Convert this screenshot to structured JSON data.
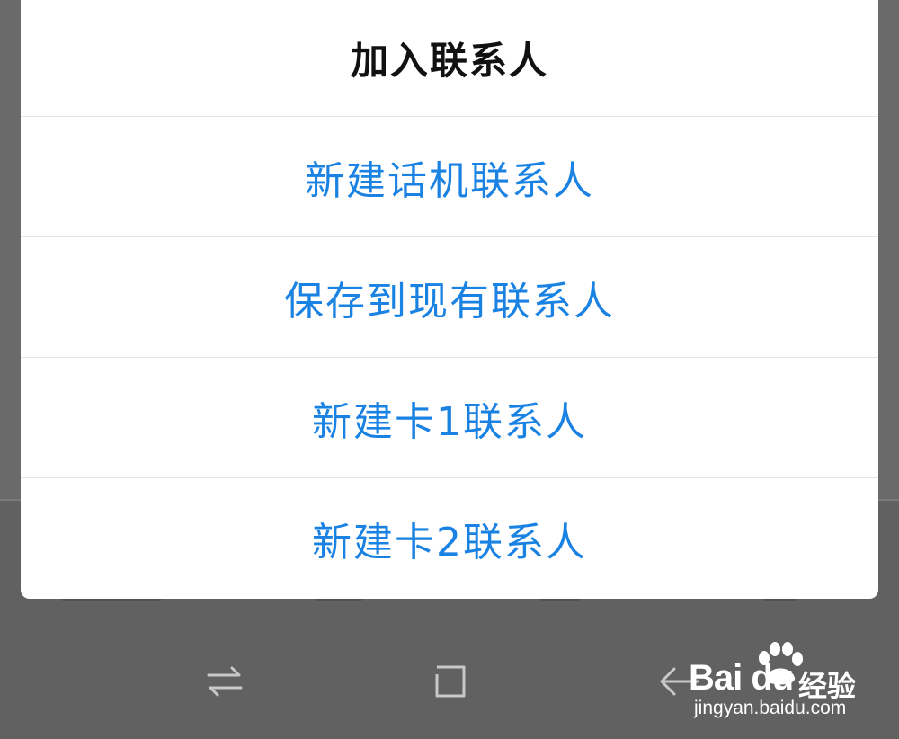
{
  "dialog": {
    "title": "加入联系人",
    "options": [
      {
        "label": "新建话机联系人"
      },
      {
        "label": "保存到现有联系人"
      },
      {
        "label": "新建卡1联系人"
      },
      {
        "label": "新建卡2联系人"
      }
    ]
  },
  "navbar": {
    "icons": [
      "recent-apps-icon",
      "home-icon",
      "back-icon"
    ]
  },
  "watermark": {
    "logo": "Bai du",
    "brand": "经验",
    "url": "jingyan.baidu.com"
  },
  "colors": {
    "accent": "#1a82e2",
    "overlay": "#616161",
    "dialog_bg": "#ffffff"
  }
}
